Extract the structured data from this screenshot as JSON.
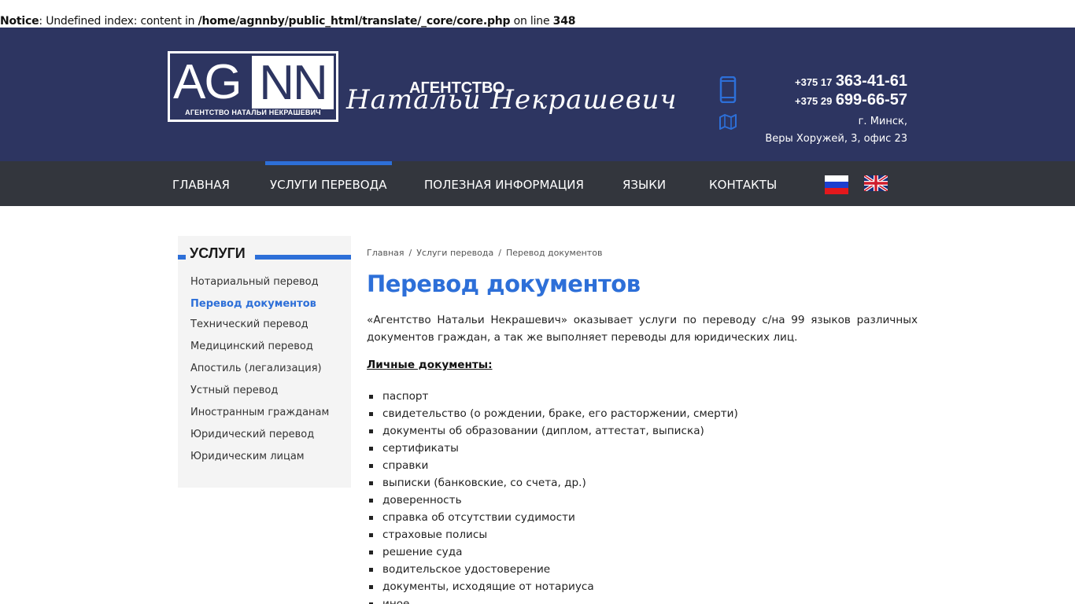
{
  "notice": {
    "label": "Notice",
    "text": ": Undefined index: content in ",
    "path": "/home/agnnby/public_html/translate/_core/core.php",
    "on_line": " on line ",
    "line": "348"
  },
  "header": {
    "logo": {
      "ag": "AG",
      "nn": "NN",
      "sub": "АГЕНТСТВО НАТАЛЬИ НЕКРАШЕВИЧ"
    },
    "agency_caption": "АГЕНТСТВО",
    "agency_script": "Натальи Некрашевич",
    "phone1": {
      "code": "+375 17",
      "number": "363-41-61"
    },
    "phone2": {
      "code": "+375 29",
      "number": "699-66-57"
    },
    "address_city": "г. Минск,",
    "address_street": "Веры Хоружей, 3, офис 23",
    "icons": [
      "phone-icon",
      "map-icon"
    ]
  },
  "nav": {
    "items": [
      "ГЛАВНАЯ",
      "УСЛУГИ ПЕРЕВОДА",
      "ПОЛЕЗНАЯ ИНФОРМАЦИЯ",
      "ЯЗЫКИ",
      "КОНТАКТЫ"
    ],
    "active": "УСЛУГИ ПЕРЕВОДА",
    "flags": [
      "flag-ru-icon",
      "flag-gb-icon"
    ]
  },
  "sidebar": {
    "title": "УСЛУГИ",
    "items": [
      "Нотариальный перевод",
      "Перевод документов",
      "Технический перевод",
      "Медицинский перевод",
      "Апостиль (легализация)",
      "Устный перевод",
      "Иностранным гражданам",
      "Юридический перевод",
      "Юридическим лицам"
    ],
    "active": "Перевод документов"
  },
  "breadcrumb": [
    "Главная",
    "Услуги перевода",
    "Перевод документов"
  ],
  "page_title": "Перевод документов",
  "intro": "«Агентство Натальи Некрашевич» оказывает услуги по переводу с/на 99 языков различных документов граждан, а так же выполняет переводы для юридических лиц.",
  "subhead": "Личные документы:",
  "documents": [
    "паспорт",
    "свидетельство (о рождении, браке, его расторжении, смерти)",
    "документы об образовании (диплом, аттестат, выписка)",
    "сертификаты",
    "справки",
    "выписки (банковские, со счета, др.)",
    "доверенность",
    "справка об отсутствии судимости",
    "страховые полисы",
    "решение суда",
    "водительское удостоверение",
    "документы, исходящие от нотариуса",
    "иное"
  ],
  "colors": {
    "header_bg": "#2d3561",
    "nav_bg": "#33363d",
    "accent": "#2d6fd8",
    "sidebar_bg": "#f4f4f4"
  }
}
